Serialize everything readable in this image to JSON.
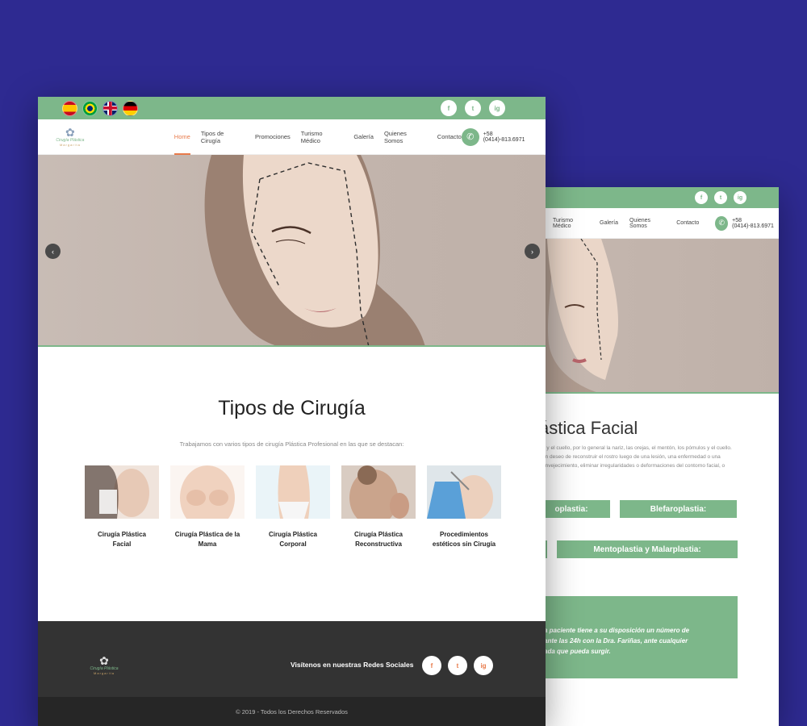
{
  "colors": {
    "background": "#2e2a91",
    "accent_green": "#7db78a",
    "accent_orange": "#e87a4a",
    "footer": "#333333"
  },
  "back_mockup": {
    "social": [
      "f",
      "t",
      "ig"
    ],
    "nav": [
      "Turismo Médico",
      "Galería",
      "Quienes Somos",
      "Contacto"
    ],
    "phone": "+58 (0414)-813.6971",
    "heading": "ástica Facial",
    "paragraph": [
      "a y el cuello, por lo general la nariz, las orejas, el mentón, los pómulos y el cuello.",
      "un deseo de reconstruir el rostro luego de una lesión, una enfermedad o una",
      "envejecimiento, eliminar irregularidades o deformaciones del contorno facial, o"
    ],
    "buttons": [
      "oplastia:",
      "Blefaroplastia:",
      "Mentoplastia y Malarplastia:"
    ],
    "callout": [
      "a paciente tiene a su disposición un número de",
      "ante las 24h con la Dra. Fariñas, ante cualquier",
      "ada que pueda surgir."
    ]
  },
  "front_mockup": {
    "flags": [
      "es",
      "br",
      "uk",
      "de"
    ],
    "social": [
      "f",
      "t",
      "ig"
    ],
    "logo": {
      "line1": "Cirugía Plástica",
      "line2": "Margarita"
    },
    "menu": [
      "Home",
      "Tipos de Cirugía",
      "Promociones",
      "Turismo Médico",
      "Galería",
      "Quienes Somos",
      "Contacto"
    ],
    "phone": "+58 (0414)-813.6971",
    "slider": {
      "prev": "‹",
      "next": "›"
    },
    "section_title": "Tipos de Cirugía",
    "section_intro": "Trabajamos con varios tipos de cirugía Plástica Profesional en las que se destacan:",
    "cards": [
      {
        "line1": "Cirugía Plástica",
        "line2": "Facial"
      },
      {
        "line1": "Cirugía Plástica de la",
        "line2": "Mama"
      },
      {
        "line1": "Cirugía Plástica",
        "line2": "Corporal"
      },
      {
        "line1": "Cirugía Plástica",
        "line2": "Reconstructiva"
      },
      {
        "line1": "Procedimientos",
        "line2": "estéticos sin Cirugía"
      }
    ],
    "footer": {
      "visit": "Visítenos en nuestras Redes Sociales",
      "copyright": "© 2019 - Todos los Derechos Reservados"
    }
  }
}
